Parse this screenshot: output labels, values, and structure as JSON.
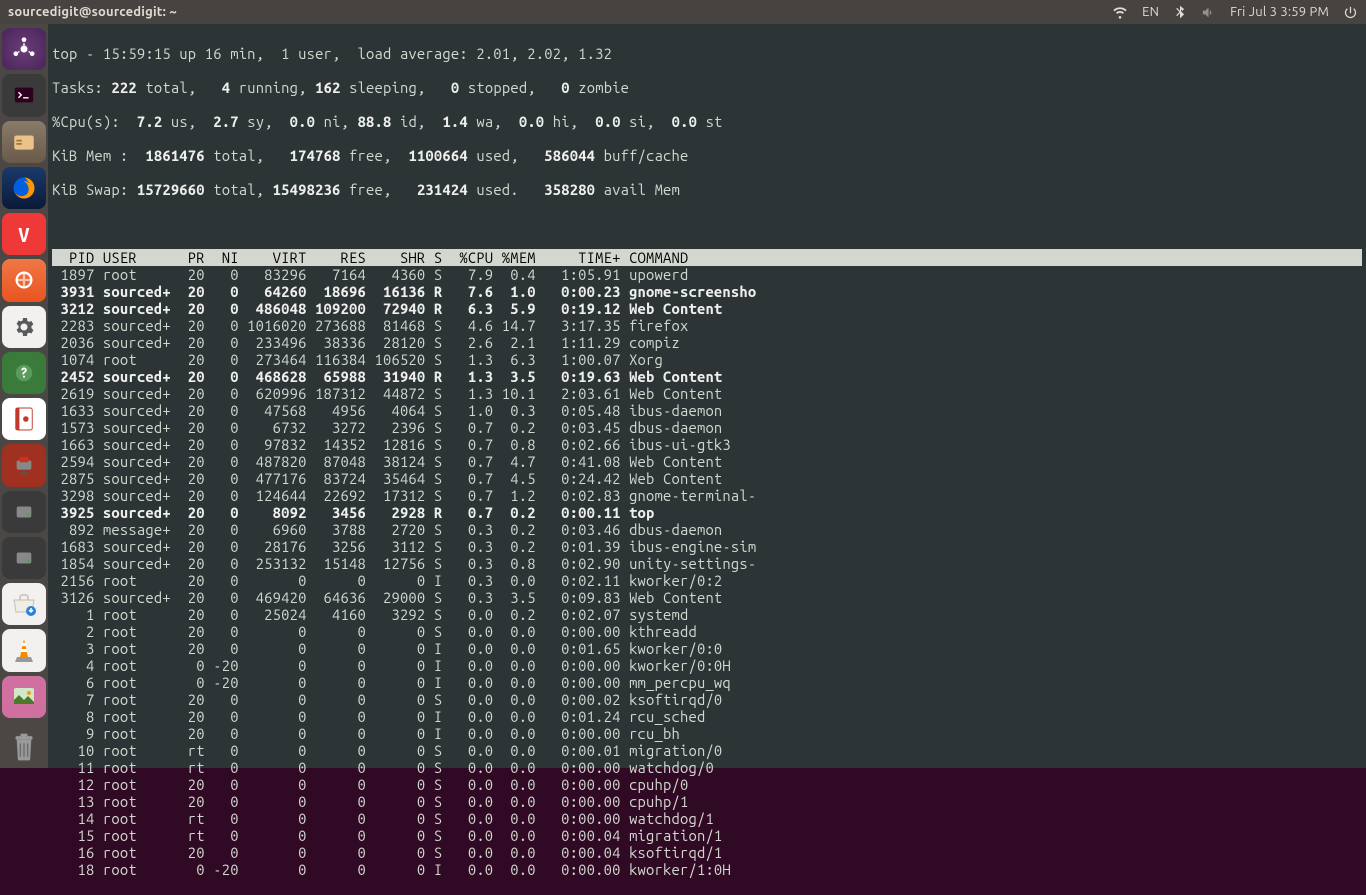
{
  "menubar": {
    "title": "sourcedigit@sourcedigit: ~",
    "lang": "EN",
    "clock": "Fri Jul 3  3:59 PM"
  },
  "top": {
    "l1_prefix": "top - 15:59:15 up 16 min,  1 user,  load average: 2.01, 2.02, 1.32",
    "l2": {
      "total": "222",
      "running": "4",
      "sleeping": "162",
      "stopped": "0",
      "zombie": "0"
    },
    "l3": {
      "us": "7.2",
      "sy": "2.7",
      "ni": "0.0",
      "id": "88.8",
      "wa": "1.4",
      "hi": "0.0",
      "si": "0.0",
      "st": "0.0"
    },
    "l4": {
      "total": "1861476",
      "free": "174768",
      "used": "1100664",
      "buff": "586044"
    },
    "l5": {
      "total": "15729660",
      "free": "15498236",
      "used": "231424",
      "avail": "358280"
    }
  },
  "columns": "  PID USER      PR  NI    VIRT    RES    SHR S  %CPU %MEM     TIME+ COMMAND",
  "rows": [
    {
      "b": 0,
      "t": " 1897 root      20   0   83296   7164   4360 S   7.9  0.4   1:05.91 upowerd"
    },
    {
      "b": 1,
      "t": " 3931 sourced+  20   0   64260  18696  16136 R   7.6  1.0   0:00.23 gnome-screensho"
    },
    {
      "b": 1,
      "t": " 3212 sourced+  20   0  486048 109200  72940 R   6.3  5.9   0:19.12 Web Content"
    },
    {
      "b": 0,
      "t": " 2283 sourced+  20   0 1016020 273688  81468 S   4.6 14.7   3:17.35 firefox"
    },
    {
      "b": 0,
      "t": " 2036 sourced+  20   0  233496  38336  28120 S   2.6  2.1   1:11.29 compiz"
    },
    {
      "b": 0,
      "t": " 1074 root      20   0  273464 116384 106520 S   1.3  6.3   1:00.07 Xorg"
    },
    {
      "b": 1,
      "t": " 2452 sourced+  20   0  468628  65988  31940 R   1.3  3.5   0:19.63 Web Content"
    },
    {
      "b": 0,
      "t": " 2619 sourced+  20   0  620996 187312  44872 S   1.3 10.1   2:03.61 Web Content"
    },
    {
      "b": 0,
      "t": " 1633 sourced+  20   0   47568   4956   4064 S   1.0  0.3   0:05.48 ibus-daemon"
    },
    {
      "b": 0,
      "t": " 1573 sourced+  20   0    6732   3272   2396 S   0.7  0.2   0:03.45 dbus-daemon"
    },
    {
      "b": 0,
      "t": " 1663 sourced+  20   0   97832  14352  12816 S   0.7  0.8   0:02.66 ibus-ui-gtk3"
    },
    {
      "b": 0,
      "t": " 2594 sourced+  20   0  487820  87048  38124 S   0.7  4.7   0:41.08 Web Content"
    },
    {
      "b": 0,
      "t": " 2875 sourced+  20   0  477176  83724  35464 S   0.7  4.5   0:24.42 Web Content"
    },
    {
      "b": 0,
      "t": " 3298 sourced+  20   0  124644  22692  17312 S   0.7  1.2   0:02.83 gnome-terminal-"
    },
    {
      "b": 1,
      "t": " 3925 sourced+  20   0    8092   3456   2928 R   0.7  0.2   0:00.11 top"
    },
    {
      "b": 0,
      "t": "  892 message+  20   0    6960   3788   2720 S   0.3  0.2   0:03.46 dbus-daemon"
    },
    {
      "b": 0,
      "t": " 1683 sourced+  20   0   28176   3256   3112 S   0.3  0.2   0:01.39 ibus-engine-sim"
    },
    {
      "b": 0,
      "t": " 1854 sourced+  20   0  253132  15148  12756 S   0.3  0.8   0:02.90 unity-settings-"
    },
    {
      "b": 0,
      "t": " 2156 root      20   0       0      0      0 I   0.3  0.0   0:02.11 kworker/0:2"
    },
    {
      "b": 0,
      "t": " 3126 sourced+  20   0  469420  64636  29000 S   0.3  3.5   0:09.83 Web Content"
    },
    {
      "b": 0,
      "t": "    1 root      20   0   25024   4160   3292 S   0.0  0.2   0:02.07 systemd"
    },
    {
      "b": 0,
      "t": "    2 root      20   0       0      0      0 S   0.0  0.0   0:00.00 kthreadd"
    },
    {
      "b": 0,
      "t": "    3 root      20   0       0      0      0 I   0.0  0.0   0:01.65 kworker/0:0"
    },
    {
      "b": 0,
      "t": "    4 root       0 -20       0      0      0 I   0.0  0.0   0:00.00 kworker/0:0H"
    },
    {
      "b": 0,
      "t": "    6 root       0 -20       0      0      0 I   0.0  0.0   0:00.00 mm_percpu_wq"
    },
    {
      "b": 0,
      "t": "    7 root      20   0       0      0      0 S   0.0  0.0   0:00.02 ksoftirqd/0"
    },
    {
      "b": 0,
      "t": "    8 root      20   0       0      0      0 I   0.0  0.0   0:01.24 rcu_sched"
    },
    {
      "b": 0,
      "t": "    9 root      20   0       0      0      0 I   0.0  0.0   0:00.00 rcu_bh"
    },
    {
      "b": 0,
      "t": "   10 root      rt   0       0      0      0 S   0.0  0.0   0:00.01 migration/0"
    },
    {
      "b": 0,
      "t": "   11 root      rt   0       0      0      0 S   0.0  0.0   0:00.00 watchdog/0"
    },
    {
      "b": 0,
      "t": "   12 root      20   0       0      0      0 S   0.0  0.0   0:00.00 cpuhp/0"
    },
    {
      "b": 0,
      "t": "   13 root      20   0       0      0      0 S   0.0  0.0   0:00.00 cpuhp/1"
    },
    {
      "b": 0,
      "t": "   14 root      rt   0       0      0      0 S   0.0  0.0   0:00.00 watchdog/1"
    },
    {
      "b": 0,
      "t": "   15 root      rt   0       0      0      0 S   0.0  0.0   0:00.04 migration/1"
    },
    {
      "b": 0,
      "t": "   16 root      20   0       0      0      0 S   0.0  0.0   0:00.04 ksoftirqd/1"
    },
    {
      "b": 0,
      "t": "   18 root       0 -20       0      0      0 I   0.0  0.0   0:00.00 kworker/1:0H"
    }
  ]
}
